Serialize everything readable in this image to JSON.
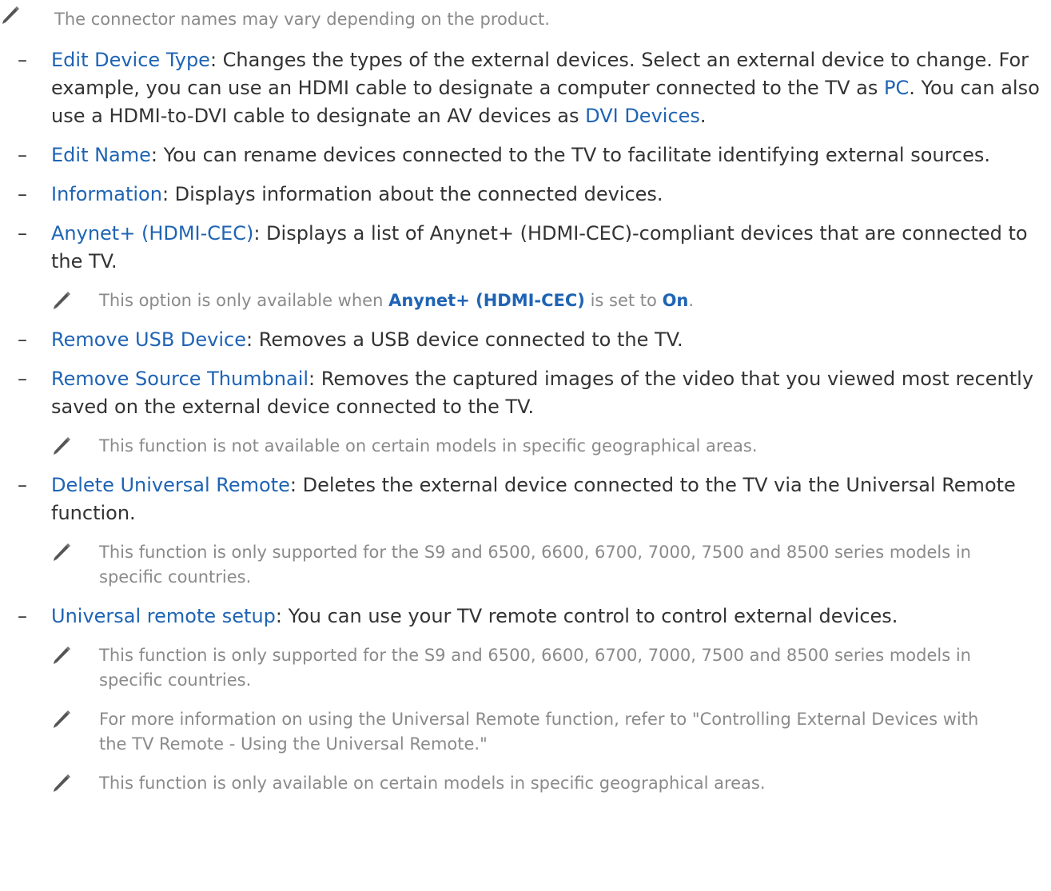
{
  "top_note": "The connector names may vary depending on the product.",
  "items": {
    "edit_device_type": {
      "term": "Edit Device Type",
      "text1": ": Changes the types of the external devices. Select an external device to change. For example, you can use an HDMI cable to designate a computer connected to the TV as ",
      "term2": "PC",
      "text2": ". You can also use a HDMI-to-DVI cable to designate an AV devices as ",
      "term3": "DVI Devices",
      "text3": "."
    },
    "edit_name": {
      "term": "Edit Name",
      "text": ": You can rename devices connected to the TV to facilitate identifying external sources."
    },
    "information": {
      "term": "Information",
      "text": ": Displays information about the connected devices."
    },
    "anynet": {
      "term": "Anynet+ (HDMI-CEC)",
      "text": ": Displays a list of Anynet+ (HDMI-CEC)-compliant devices that are connected to the TV.",
      "note_pre": "This option is only available when ",
      "note_term": "Anynet+ (HDMI-CEC)",
      "note_mid": " is set to ",
      "note_term2": "On",
      "note_post": "."
    },
    "remove_usb": {
      "term": "Remove USB Device",
      "text": ": Removes a USB device connected to the TV."
    },
    "remove_thumbnail": {
      "term": "Remove Source Thumbnail",
      "text": ": Removes the captured images of the video that you viewed most recently saved on the external device connected to the TV.",
      "note": "This function is not available on certain models in specific geographical areas."
    },
    "delete_universal_remote": {
      "term": "Delete Universal Remote",
      "text": ": Deletes the external device connected to the TV via the Universal Remote function.",
      "note": "This function is only supported for the S9 and 6500, 6600, 6700, 7000, 7500 and 8500 series models in specific countries."
    },
    "universal_remote_setup": {
      "term": "Universal remote setup",
      "text": ": You can use your TV remote control to control external devices.",
      "note1": "This function is only supported for the S9 and 6500, 6600, 6700, 7000, 7500 and 8500 series models in specific countries.",
      "note2": "For more information on using the Universal Remote function, refer to \"Controlling External Devices with the TV Remote - Using the Universal Remote.\"",
      "note3": "This function is only available on certain models in specific geographical areas."
    }
  },
  "colors": {
    "term": "#1f64b4",
    "body_text": "#333333",
    "note_text": "#8a8a8a"
  }
}
